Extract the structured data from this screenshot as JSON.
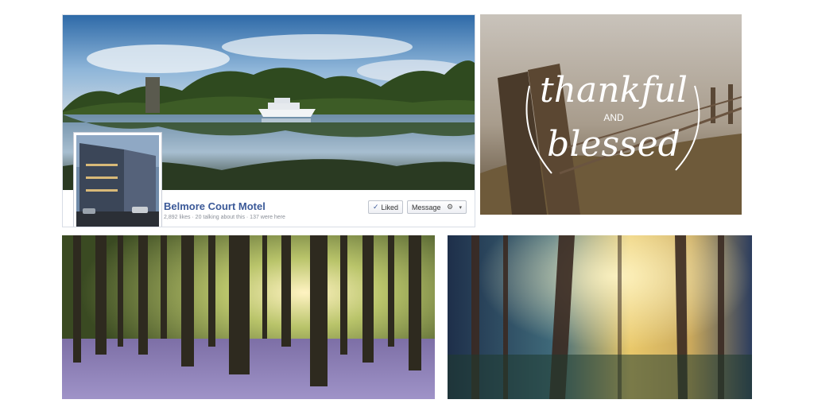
{
  "facebook_page": {
    "name": "Belmore Court Motel",
    "stats": "2,892 likes · 20 talking about this · 137 were here",
    "liked_label": "Liked",
    "message_label": "Message",
    "gear_glyph": "⚙",
    "liked_check": "✓",
    "caret_glyph": "▾",
    "motel_sign": "Belmore Court Motel"
  },
  "quote_image": {
    "line1": "thankful",
    "line2": "AND",
    "line3": "blessed"
  },
  "colors": {
    "fb_link": "#3b5998",
    "stats_gray": "#8a8f98"
  },
  "icons": [
    "check-icon",
    "gear-icon",
    "chevron-down-icon"
  ]
}
